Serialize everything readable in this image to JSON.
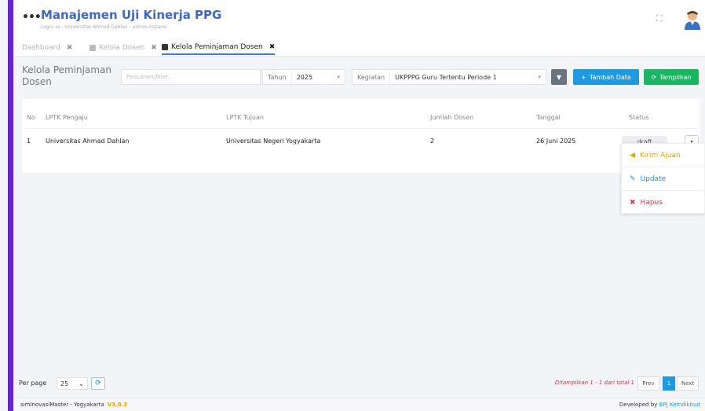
{
  "header": {
    "title": "Manajemen Uji Kinerja PPG",
    "subtitle": "Login as : Universitas Ahmad Dahlan - admin-instansi",
    "menu_glyph": "•••",
    "expand_glyph": "⛶"
  },
  "tabs": [
    {
      "label": "Dashboard",
      "close": "✖",
      "active": false
    },
    {
      "label": "Kelola Dosen",
      "close": "✖",
      "active": false
    },
    {
      "label": "Kelola Peminjaman Dosen",
      "close": "✖",
      "active": true
    }
  ],
  "toolbar": {
    "page_title": "Kelola Peminjaman Dosen",
    "search_placeholder": "Pencarian/filter..",
    "tahun_label": "Tahun",
    "tahun_value": "2025",
    "kegiatan_label": "Kegiatan",
    "kegiatan_value": "UKPPPG Guru Tertentu Periode 1",
    "filter_glyph": "▼",
    "add_label": "Tambah Data",
    "add_glyph": "+",
    "show_label": "Tampilkan",
    "show_glyph": "⟳"
  },
  "table": {
    "headers": {
      "no": "No",
      "lptk_pengaju": "LPTK Pengaju",
      "lptk_tujuan": "LPTK Tujuan",
      "jumlah_dosen": "Jumlah Dosen",
      "tanggal": "Tanggal",
      "status": "Status"
    },
    "rows": [
      {
        "no": "1",
        "lptk_pengaju": "Universitas Ahmad Dahlan",
        "lptk_tujuan": "Universitas Negeri Yogyakarta",
        "jumlah_dosen": "2",
        "tanggal": "26 Juni 2025",
        "status": "draft",
        "action_glyph": "▾"
      }
    ]
  },
  "dropdown": {
    "items": [
      {
        "label": "Kirim Ajuan",
        "icon": "send-icon",
        "glyph": "◀",
        "color": "#e0a800"
      },
      {
        "label": "Update",
        "icon": "pencil-icon",
        "glyph": "✎",
        "color": "#1d8fd8"
      },
      {
        "label": "Hapus",
        "icon": "delete-icon",
        "glyph": "✖",
        "color": "#e0344a"
      }
    ]
  },
  "pagination": {
    "per_page_label": "Per page",
    "per_page_value": "25",
    "per_page_caret": "⌄",
    "refresh_glyph": "⟳",
    "info": "Ditampilkan 1 - 1 dari total 1",
    "prev": "Prev",
    "current": "1",
    "next": "Next"
  },
  "statusbar": {
    "left": "simInovasiMaster - Yogyakarta",
    "version": "V3.0.3",
    "right_prefix": "Developed by",
    "right_org": "BPJ Kemdikbud"
  },
  "colors": {
    "accent": "#3e67c6",
    "sidebar_bar": "#6a24c8",
    "primary_btn": "#1e9be0",
    "success_btn": "#19b563",
    "danger": "#e0344a"
  }
}
